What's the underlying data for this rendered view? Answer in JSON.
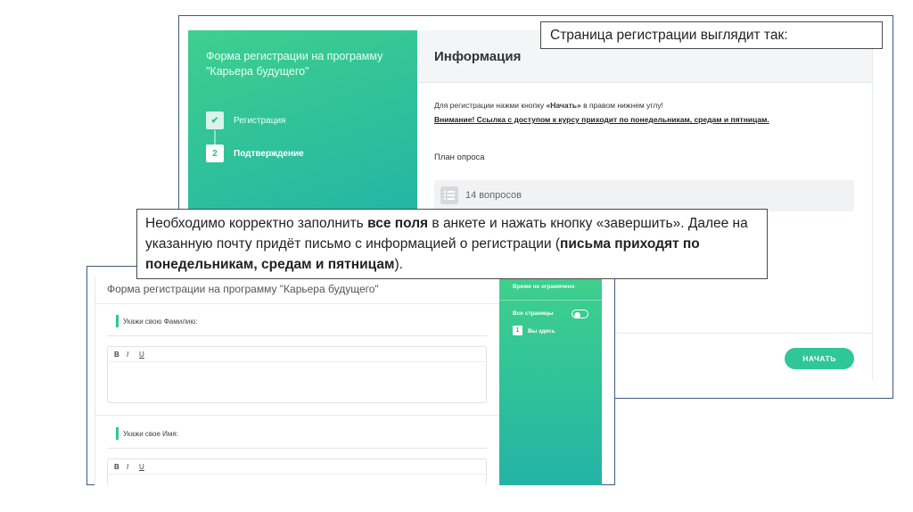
{
  "slide": {
    "caption_top": "Страница регистрации выглядит так:",
    "caption_middle": {
      "part1": "Необходимо корректно заполнить ",
      "bold1": "все поля",
      "part2": " в анкете и нажать кнопку «завершить». Далее на указанную почту придёт письмо с информацией о регистрации (",
      "bold2": "письма приходят по понедельникам, средам и пятницам",
      "part3": ")."
    }
  },
  "registration_page": {
    "sidebar": {
      "title": "Форма регистрации на программу \"Карьера будущего\"",
      "steps": [
        {
          "marker": "✔",
          "label": "Регистрация"
        },
        {
          "marker": "2",
          "label": "Подтверждение"
        }
      ]
    },
    "info": {
      "heading": "Информация",
      "text_prefix": "Для регистрации нажми кнопку ",
      "text_bold": "«Начать»",
      "text_suffix": " в правом нижнем углу!",
      "warning": "Внимание! Ссылка с доступом к курсу приходит по понедельникам, средам и пятницам.",
      "plan_label": "План опроса",
      "questions_count": "14 вопросов",
      "start_button": "НАЧАТЬ"
    }
  },
  "form_page": {
    "title": "Форма регистрации на программу \"Карьера будущего\"",
    "questions": [
      {
        "label": "Укажи свою Фамилию:"
      },
      {
        "label": "Укажи свое Имя:"
      }
    ],
    "toolbar": {
      "bold": "B",
      "italic": "I",
      "underline": "U"
    },
    "sidebar": {
      "time_label": "Время не ограничено",
      "all_pages_label": "Все страницы",
      "page_number": "1",
      "you_are_here": "Вы здесь"
    }
  },
  "colors": {
    "accent_green": "#2fc797",
    "frame_border": "#3d5a80"
  }
}
